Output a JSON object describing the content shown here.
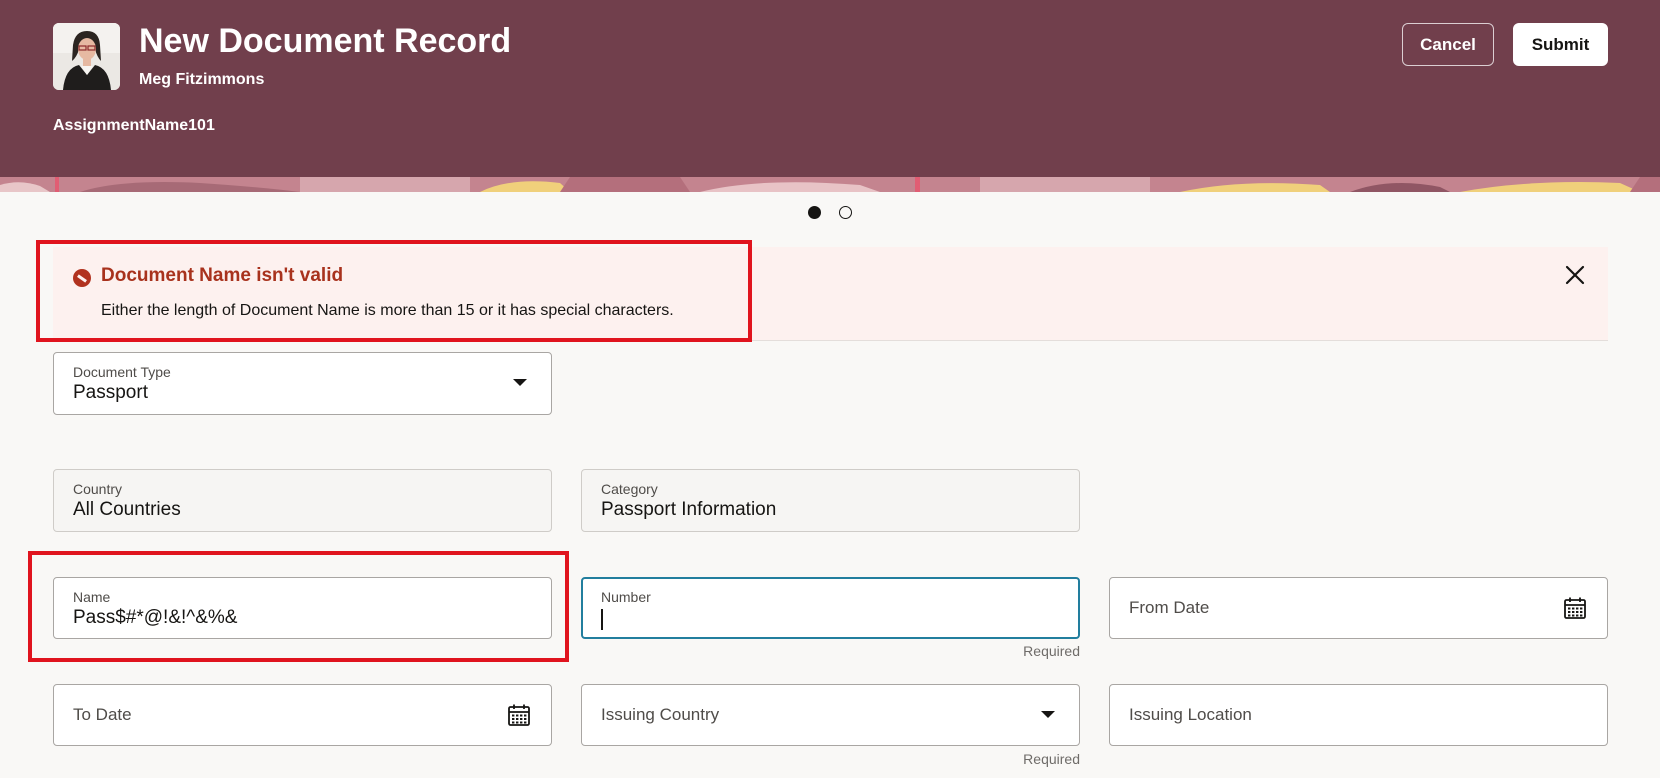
{
  "header": {
    "title": "New Document Record",
    "person_name": "Meg Fitzimmons",
    "assignment": "AssignmentName101",
    "cancel_label": "Cancel",
    "submit_label": "Submit"
  },
  "pager": {
    "current": 1,
    "total": 2
  },
  "alert": {
    "title": "Document Name isn't valid",
    "message": "Either the length of Document Name is more than 15 or it has special characters."
  },
  "form": {
    "document_type": {
      "label": "Document Type",
      "value": "Passport"
    },
    "country": {
      "label": "Country",
      "value": "All Countries"
    },
    "category": {
      "label": "Category",
      "value": "Passport Information"
    },
    "name": {
      "label": "Name",
      "value": "Pass$#*@!&!^&%&"
    },
    "number": {
      "label": "Number",
      "value": "",
      "hint": "Required"
    },
    "from_date": {
      "label": "From Date"
    },
    "to_date": {
      "label": "To Date"
    },
    "issuing_country": {
      "label": "Issuing Country",
      "hint": "Required"
    },
    "issuing_location": {
      "label": "Issuing Location"
    }
  },
  "colors": {
    "header_bg": "#713f4c",
    "error": "#a8321d",
    "highlight": "#e0141e",
    "focus": "#227e9e"
  },
  "icons": [
    "avatar-photo",
    "error-icon",
    "close-icon",
    "chevron-down-icon",
    "calendar-icon"
  ]
}
